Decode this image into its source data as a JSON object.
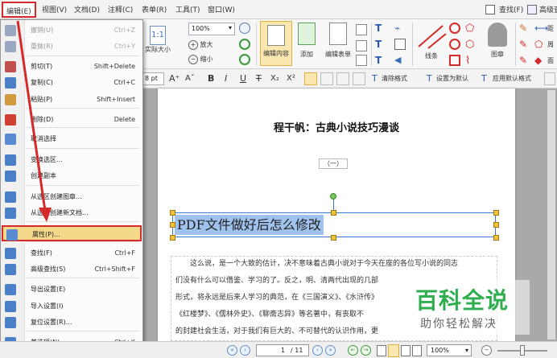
{
  "menubar": {
    "items": [
      "编辑(E)",
      "视图(V)",
      "文档(D)",
      "注释(C)",
      "表单(R)",
      "工具(T)",
      "窗口(W)"
    ],
    "right": [
      "查找(F)",
      "高级查找"
    ]
  },
  "ribbon": {
    "actual_size": "实际大小",
    "zoom_value": "100%",
    "zoom_in": "放大",
    "zoom_out": "缩小",
    "edit_content": "编辑内容",
    "add": "添加",
    "edit_form": "编辑表单",
    "line": "线条",
    "stamp": "图章",
    "right_partial": [
      "距",
      "周",
      "面"
    ]
  },
  "format": {
    "font_size": "8 pt",
    "clear_format": "清除格式",
    "set_default": "设置为默认",
    "apply_default": "应用默认格式"
  },
  "document": {
    "title": "程干帆：古典小说技巧漫谈",
    "section": "（一）",
    "selected_text": "PDF文件做好后怎么修改",
    "paragraph": [
      "这么说，是一个大致的估计，决不意味着古典小说对于今天在座的各位写小说的同志",
      "们没有什么可以借鉴、学习的了。反之，明、清两代出现的几部",
      "形式，将永远是后来人学习的典范，在《三国演义》、《水浒传》",
      "《红楼梦》、《儒林外史》、《聊斋志异》等名著中，有丧取不",
      "的封建社会生活，对于我们有巨大的、不可替代的认识作用，更"
    ]
  },
  "edit_menu": {
    "items": [
      {
        "label": "撤销(U)",
        "shortcut": "Ctrl+Z",
        "disabled": true,
        "color": "#9aa8c2"
      },
      {
        "label": "重做(R)",
        "shortcut": "Ctrl+Y",
        "disabled": true,
        "color": "#9aa8c2"
      },
      {
        "label": "剪切(T)",
        "shortcut": "Shift+Delete",
        "disabled": false,
        "color": "#c05050"
      },
      {
        "label": "复制(C)",
        "shortcut": "Ctrl+C",
        "disabled": false,
        "color": "#4a80c8"
      },
      {
        "label": "粘贴(P)",
        "shortcut": "Shift+Insert",
        "disabled": false,
        "color": "#d09a40"
      },
      {
        "label": "删除(D)",
        "shortcut": "Delete",
        "disabled": false,
        "color": "#d04030"
      },
      {
        "label": "取消选择",
        "shortcut": "",
        "disabled": false,
        "color": "#5a8ad0"
      },
      {
        "label": "变换选区...",
        "shortcut": "",
        "disabled": false,
        "color": "#4a80c8"
      },
      {
        "label": "创建副本",
        "shortcut": "",
        "disabled": false,
        "color": "#4a80c8"
      },
      {
        "label": "从选区创建图章...",
        "shortcut": "",
        "disabled": false,
        "color": "#4a80c8"
      },
      {
        "label": "从选区创建新文档...",
        "shortcut": "",
        "disabled": false,
        "color": "#4a80c8"
      },
      {
        "label": "属性(P)...",
        "shortcut": "",
        "disabled": false,
        "color": "#5a8ad0"
      },
      {
        "label": "查找(F)",
        "shortcut": "Ctrl+F",
        "disabled": false,
        "color": "#4a80c8"
      },
      {
        "label": "高级查找(S)",
        "shortcut": "Ctrl+Shift+F",
        "disabled": false,
        "color": "#4a80c8"
      },
      {
        "label": "导出设置(E)",
        "shortcut": "",
        "disabled": false,
        "color": "#4a80c8"
      },
      {
        "label": "导入设置(I)",
        "shortcut": "",
        "disabled": false,
        "color": "#4a80c8"
      },
      {
        "label": "复位设置(R)...",
        "shortcut": "",
        "disabled": false,
        "color": "#4a80c8"
      },
      {
        "label": "首选项(N)...",
        "shortcut": "Ctrl+K",
        "disabled": false,
        "color": "#4a80c8"
      }
    ]
  },
  "statusbar": {
    "page": "1",
    "page_total": "/ 11",
    "zoom": "100%"
  },
  "watermark": {
    "brand": "百科全说",
    "slogan": "助你轻松解决"
  },
  "colors": {
    "highlight_red": "#d42a2a",
    "selection_blue": "#9fc3ee",
    "hover_yellow": "#f5d98b",
    "watermark_green": "#2fae4f"
  }
}
